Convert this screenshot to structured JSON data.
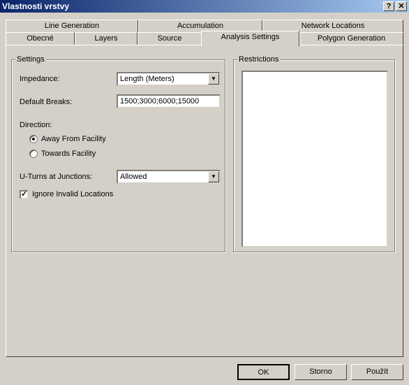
{
  "window": {
    "title": "Vlastnosti vrstvy",
    "help": "?",
    "close": "✕"
  },
  "tabs_back": [
    {
      "label": "Line Generation"
    },
    {
      "label": "Accumulation"
    },
    {
      "label": "Network Locations"
    }
  ],
  "tabs_front": [
    {
      "label": "Obecné"
    },
    {
      "label": "Layers"
    },
    {
      "label": "Source"
    },
    {
      "label": "Analysis Settings",
      "active": true
    },
    {
      "label": "Polygon Generation"
    }
  ],
  "settings": {
    "group_label": "Settings",
    "impedance_label": "Impedance:",
    "impedance_value": "Length (Meters)",
    "breaks_label": "Default Breaks:",
    "breaks_value": "1500;3000;6000;15000",
    "direction_label": "Direction:",
    "away_label": "Away From Facility",
    "away_selected": true,
    "towards_label": "Towards Facility",
    "towards_selected": false,
    "uturns_label": "U-Turns at Junctions:",
    "uturns_value": "Allowed",
    "ignore_label": "Ignore Invalid Locations",
    "ignore_checked": true
  },
  "restrictions": {
    "group_label": "Restrictions"
  },
  "buttons": {
    "ok": "OK",
    "cancel": "Storno",
    "apply": "Použít"
  }
}
